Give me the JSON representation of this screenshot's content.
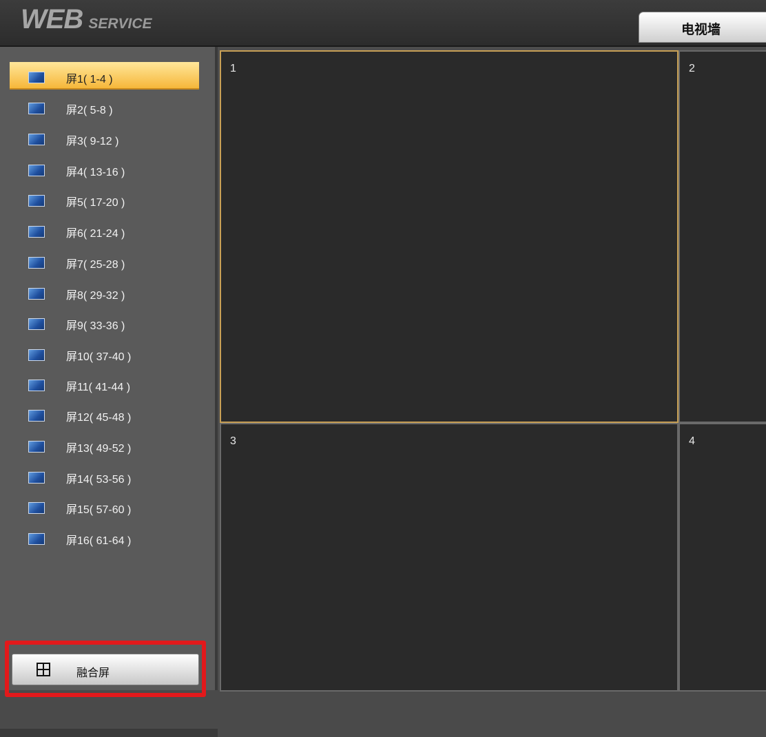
{
  "header": {
    "logo_main": "WEB",
    "logo_sub": "SERVICE",
    "tab_label": "电视墙"
  },
  "sidebar": {
    "items": [
      {
        "label": "屏1( 1-4 )",
        "selected": true
      },
      {
        "label": "屏2( 5-8 )"
      },
      {
        "label": "屏3( 9-12 )"
      },
      {
        "label": "屏4( 13-16 )"
      },
      {
        "label": "屏5( 17-20 )"
      },
      {
        "label": "屏6( 21-24 )"
      },
      {
        "label": "屏7( 25-28 )"
      },
      {
        "label": "屏8( 29-32 )"
      },
      {
        "label": "屏9( 33-36 )"
      },
      {
        "label": "屏10( 37-40 )"
      },
      {
        "label": "屏11( 41-44 )"
      },
      {
        "label": "屏12( 45-48 )"
      },
      {
        "label": "屏13( 49-52 )"
      },
      {
        "label": "屏14( 53-56 )"
      },
      {
        "label": "屏15( 57-60 )"
      },
      {
        "label": "屏16( 61-64 )"
      }
    ],
    "fuse_button": "融合屏"
  },
  "panes": [
    "1",
    "2",
    "3",
    "4"
  ],
  "colors": {
    "selected_item": "#f6b73a",
    "active_pane_border": "#c8a055",
    "highlight_box": "#e2191b"
  }
}
